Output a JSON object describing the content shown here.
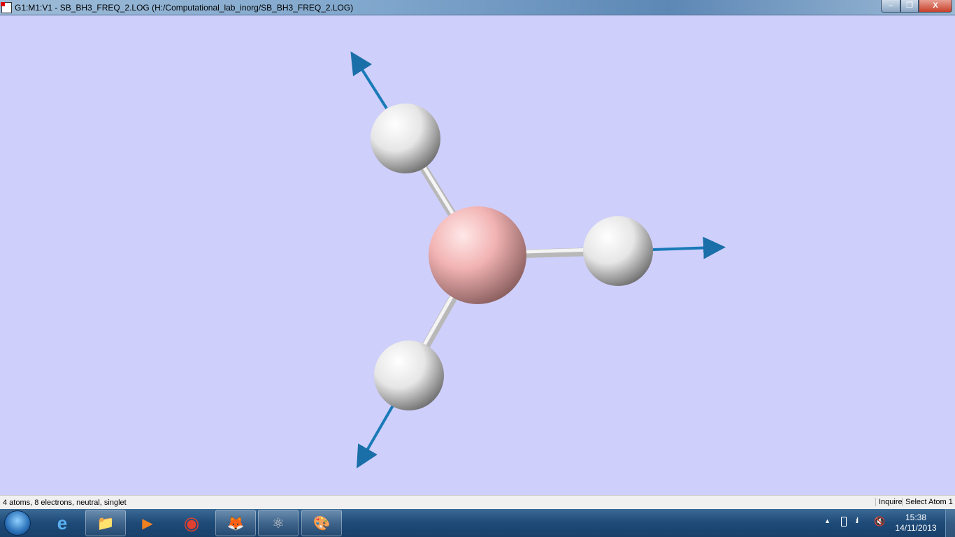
{
  "window": {
    "title": "G1:M1:V1 - SB_BH3_FREQ_2.LOG (H:/Computational_lab_inorg/SB_BH3_FREQ_2.LOG)",
    "minimize": "–",
    "maximize": "❐",
    "close": "X"
  },
  "molecule": {
    "atoms": [
      {
        "element": "H",
        "color": "#ffffff"
      },
      {
        "element": "B",
        "color": "#f4b5b5"
      },
      {
        "element": "H",
        "color": "#ffffff"
      },
      {
        "element": "H",
        "color": "#ffffff"
      }
    ],
    "background": "#cfcffb",
    "vector_color": "#1a7ab8"
  },
  "status": {
    "info": "4 atoms, 8 electrons, neutral, singlet",
    "mode": "Inquire",
    "action": "Select Atom 1"
  },
  "taskbar": {
    "time": "15:38",
    "date": "14/11/2013",
    "apps": [
      {
        "icon": "internet-explorer-icon",
        "glyph": "e"
      },
      {
        "icon": "file-explorer-icon",
        "glyph": "📁"
      },
      {
        "icon": "media-player-icon",
        "glyph": "▶"
      },
      {
        "icon": "chrome-icon",
        "glyph": "◉"
      },
      {
        "icon": "firefox-icon",
        "glyph": "🦊"
      },
      {
        "icon": "gaussview-icon",
        "glyph": "⚛"
      },
      {
        "icon": "paint-icon",
        "glyph": "🎨"
      }
    ]
  }
}
